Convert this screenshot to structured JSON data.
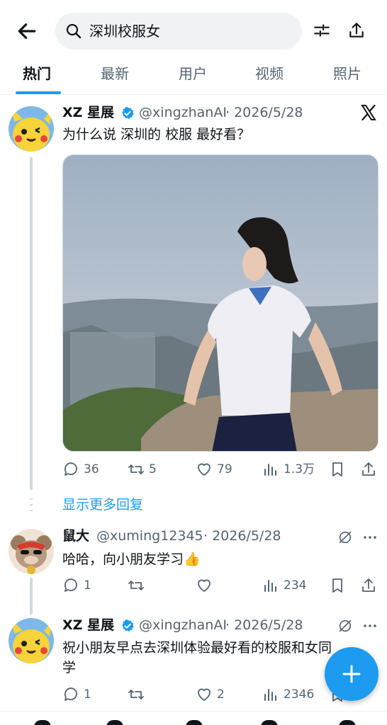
{
  "search": {
    "query": "深圳校服女"
  },
  "tabs": [
    "热门",
    "最新",
    "用户",
    "视频",
    "照片"
  ],
  "tweets": [
    {
      "name": "XZ 星展",
      "handle": "@xingzhanAI",
      "date": "· 2026/5/28",
      "text": "为什么说 深圳的 校服 最好看？",
      "replies": "36",
      "retweets": "5",
      "likes": "79",
      "views": "1.3万"
    },
    {
      "name": "鼠大",
      "handle": "@xuming12345",
      "date": "· 2026/5/28",
      "text": "哈哈，向小朋友学习👍",
      "replies": "1",
      "retweets": "",
      "likes": "",
      "views": "234"
    },
    {
      "name": "XZ 星展",
      "handle": "@xingzhanAI",
      "date": "· 2026/5/28",
      "text_line1": "祝小朋友早点去深圳体验最好看的校服和女同",
      "text_line2": "学",
      "replies": "1",
      "retweets": "",
      "likes": "2",
      "views": "2346"
    }
  ],
  "show_more": "显示更多回复",
  "colors": {
    "accent": "#1d9bf0",
    "secondary_text": "#536471",
    "primary_text": "#0f1419"
  },
  "icons": [
    "back-arrow-icon",
    "search-icon",
    "filter-icon",
    "share-icon",
    "x-logo-icon",
    "verified-badge-icon",
    "grok-icon",
    "more-icon",
    "reply-icon",
    "retweet-icon",
    "like-icon",
    "views-icon",
    "bookmark-icon",
    "compose-plus-icon"
  ]
}
